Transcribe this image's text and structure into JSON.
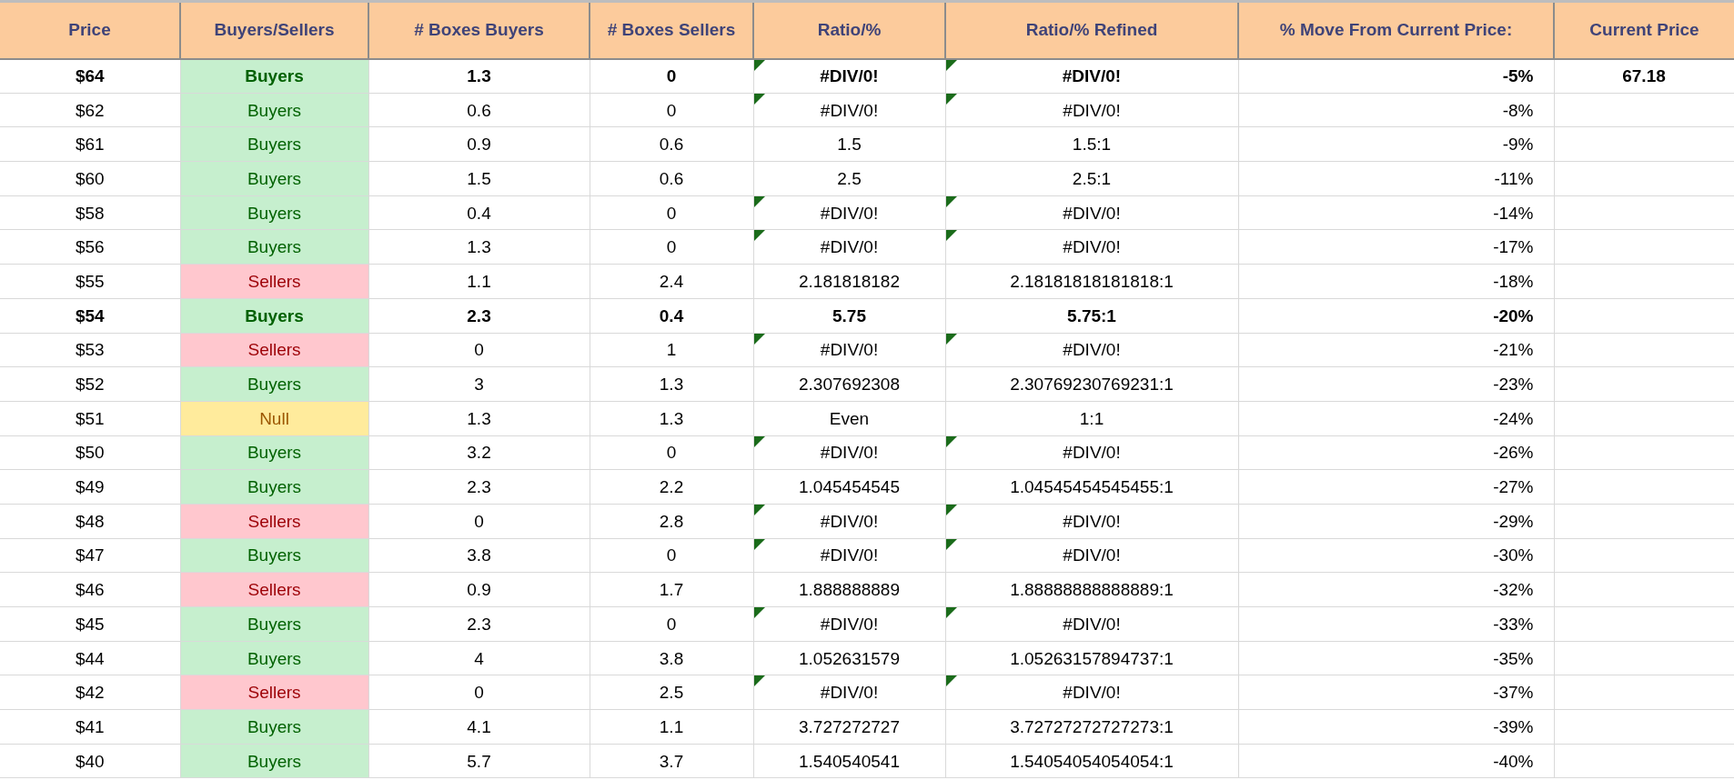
{
  "columns": [
    "Price",
    "Buyers/Sellers",
    "# Boxes Buyers",
    "# Boxes Sellers",
    "Ratio/%",
    "Ratio/% Refined",
    "% Move From Current Price:",
    "Current Price"
  ],
  "rows": [
    {
      "price": "$64",
      "signal": {
        "kind": "buyers",
        "text": "Buyers"
      },
      "boxes_buyers": "1.3",
      "boxes_sellers": "0",
      "ratio": "#DIV/0!",
      "ratio_refined": "#DIV/0!",
      "move": "-5%",
      "current_price": "67.18",
      "bold": true,
      "flagged": true
    },
    {
      "price": "$62",
      "signal": {
        "kind": "buyers",
        "text": "Buyers"
      },
      "boxes_buyers": "0.6",
      "boxes_sellers": "0",
      "ratio": "#DIV/0!",
      "ratio_refined": "#DIV/0!",
      "move": "-8%",
      "bold": false,
      "flagged": true
    },
    {
      "price": "$61",
      "signal": {
        "kind": "buyers",
        "text": "Buyers"
      },
      "boxes_buyers": "0.9",
      "boxes_sellers": "0.6",
      "ratio": "1.5",
      "ratio_refined": "1.5:1",
      "move": "-9%",
      "bold": false,
      "flagged": false
    },
    {
      "price": "$60",
      "signal": {
        "kind": "buyers",
        "text": "Buyers"
      },
      "boxes_buyers": "1.5",
      "boxes_sellers": "0.6",
      "ratio": "2.5",
      "ratio_refined": "2.5:1",
      "move": "-11%",
      "bold": false,
      "flagged": false
    },
    {
      "price": "$58",
      "signal": {
        "kind": "buyers",
        "text": "Buyers"
      },
      "boxes_buyers": "0.4",
      "boxes_sellers": "0",
      "ratio": "#DIV/0!",
      "ratio_refined": "#DIV/0!",
      "move": "-14%",
      "bold": false,
      "flagged": true
    },
    {
      "price": "$56",
      "signal": {
        "kind": "buyers",
        "text": "Buyers"
      },
      "boxes_buyers": "1.3",
      "boxes_sellers": "0",
      "ratio": "#DIV/0!",
      "ratio_refined": "#DIV/0!",
      "move": "-17%",
      "bold": false,
      "flagged": true
    },
    {
      "price": "$55",
      "signal": {
        "kind": "sellers",
        "text": "Sellers"
      },
      "boxes_buyers": "1.1",
      "boxes_sellers": "2.4",
      "ratio": "2.181818182",
      "ratio_refined": "2.18181818181818:1",
      "move": "-18%",
      "bold": false,
      "flagged": false
    },
    {
      "price": "$54",
      "signal": {
        "kind": "buyers",
        "text": "Buyers"
      },
      "boxes_buyers": "2.3",
      "boxes_sellers": "0.4",
      "ratio": "5.75",
      "ratio_refined": "5.75:1",
      "move": "-20%",
      "bold": true,
      "flagged": false
    },
    {
      "price": "$53",
      "signal": {
        "kind": "sellers",
        "text": "Sellers"
      },
      "boxes_buyers": "0",
      "boxes_sellers": "1",
      "ratio": "#DIV/0!",
      "ratio_refined": "#DIV/0!",
      "move": "-21%",
      "bold": false,
      "flagged": true
    },
    {
      "price": "$52",
      "signal": {
        "kind": "buyers",
        "text": "Buyers"
      },
      "boxes_buyers": "3",
      "boxes_sellers": "1.3",
      "ratio": "2.307692308",
      "ratio_refined": "2.30769230769231:1",
      "move": "-23%",
      "bold": false,
      "flagged": false
    },
    {
      "price": "$51",
      "signal": {
        "kind": "null",
        "text": "Null"
      },
      "boxes_buyers": "1.3",
      "boxes_sellers": "1.3",
      "ratio": "Even",
      "ratio_refined": "1:1",
      "move": "-24%",
      "bold": false,
      "flagged": false
    },
    {
      "price": "$50",
      "signal": {
        "kind": "buyers",
        "text": "Buyers"
      },
      "boxes_buyers": "3.2",
      "boxes_sellers": "0",
      "ratio": "#DIV/0!",
      "ratio_refined": "#DIV/0!",
      "move": "-26%",
      "bold": false,
      "flagged": true
    },
    {
      "price": "$49",
      "signal": {
        "kind": "buyers",
        "text": "Buyers"
      },
      "boxes_buyers": "2.3",
      "boxes_sellers": "2.2",
      "ratio": "1.045454545",
      "ratio_refined": "1.04545454545455:1",
      "move": "-27%",
      "bold": false,
      "flagged": false
    },
    {
      "price": "$48",
      "signal": {
        "kind": "sellers",
        "text": "Sellers"
      },
      "boxes_buyers": "0",
      "boxes_sellers": "2.8",
      "ratio": "#DIV/0!",
      "ratio_refined": "#DIV/0!",
      "move": "-29%",
      "bold": false,
      "flagged": true
    },
    {
      "price": "$47",
      "signal": {
        "kind": "buyers",
        "text": "Buyers"
      },
      "boxes_buyers": "3.8",
      "boxes_sellers": "0",
      "ratio": "#DIV/0!",
      "ratio_refined": "#DIV/0!",
      "move": "-30%",
      "bold": false,
      "flagged": true
    },
    {
      "price": "$46",
      "signal": {
        "kind": "sellers",
        "text": "Sellers"
      },
      "boxes_buyers": "0.9",
      "boxes_sellers": "1.7",
      "ratio": "1.888888889",
      "ratio_refined": "1.88888888888889:1",
      "move": "-32%",
      "bold": false,
      "flagged": false
    },
    {
      "price": "$45",
      "signal": {
        "kind": "buyers",
        "text": "Buyers"
      },
      "boxes_buyers": "2.3",
      "boxes_sellers": "0",
      "ratio": "#DIV/0!",
      "ratio_refined": "#DIV/0!",
      "move": "-33%",
      "bold": false,
      "flagged": true
    },
    {
      "price": "$44",
      "signal": {
        "kind": "buyers",
        "text": "Buyers"
      },
      "boxes_buyers": "4",
      "boxes_sellers": "3.8",
      "ratio": "1.052631579",
      "ratio_refined": "1.05263157894737:1",
      "move": "-35%",
      "bold": false,
      "flagged": false
    },
    {
      "price": "$42",
      "signal": {
        "kind": "sellers",
        "text": "Sellers"
      },
      "boxes_buyers": "0",
      "boxes_sellers": "2.5",
      "ratio": "#DIV/0!",
      "ratio_refined": "#DIV/0!",
      "move": "-37%",
      "bold": false,
      "flagged": true
    },
    {
      "price": "$41",
      "signal": {
        "kind": "buyers",
        "text": "Buyers"
      },
      "boxes_buyers": "4.1",
      "boxes_sellers": "1.1",
      "ratio": "3.727272727",
      "ratio_refined": "3.72727272727273:1",
      "move": "-39%",
      "bold": false,
      "flagged": false
    },
    {
      "price": "$40",
      "signal": {
        "kind": "buyers",
        "text": "Buyers"
      },
      "boxes_buyers": "5.7",
      "boxes_sellers": "3.7",
      "ratio": "1.540540541",
      "ratio_refined": "1.54054054054054:1",
      "move": "-40%",
      "bold": false,
      "flagged": false
    }
  ]
}
